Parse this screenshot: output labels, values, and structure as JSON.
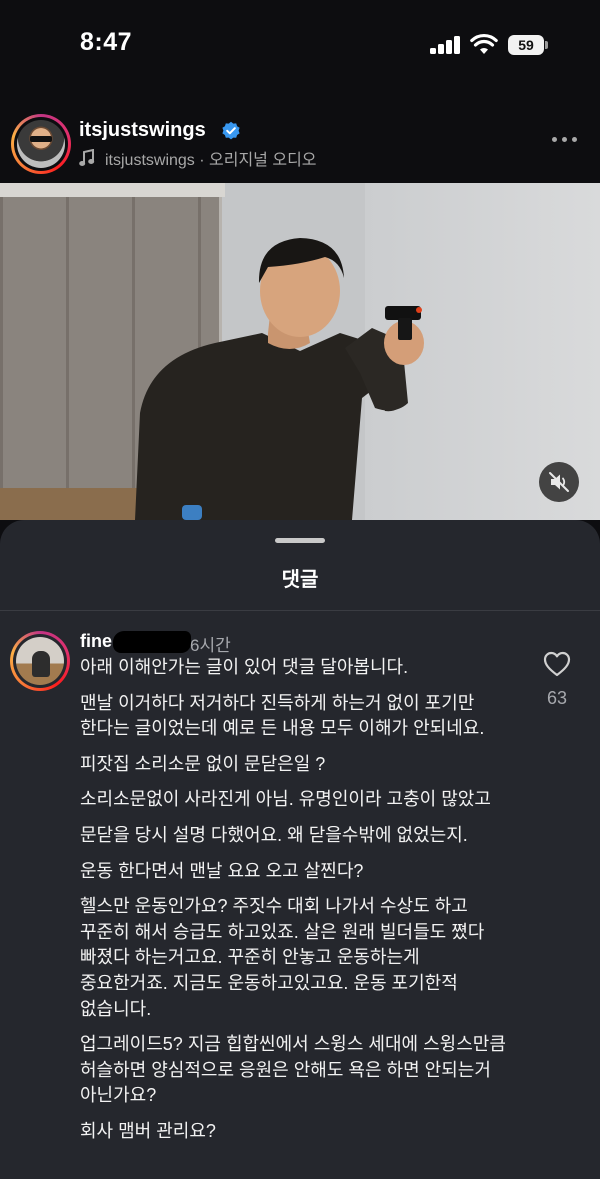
{
  "status_bar": {
    "time": "8:47",
    "battery": "59"
  },
  "post": {
    "username": "itsjustswings",
    "audio_label": "itsjustswings · 오리지널 오디오",
    "verified_color": "#3897f0"
  },
  "comments_sheet": {
    "title": "댓글",
    "comment": {
      "username": "fine",
      "time": "6시간",
      "like_count": "63",
      "paragraphs": [
        "아래 이해안가는 글이 있어 댓글 달아봅니다.",
        "맨날 이거하다 저거하다 진득하게 하는거 없이 포기만 한다는 글이었는데 예로 든 내용 모두 이해가 안되네요.",
        "피잣집 소리소문 없이 문닫은일 ?",
        "소리소문없이 사라진게 아님. 유명인이라 고충이 많았고",
        "문닫을 당시 설명 다했어요. 왜 닫을수밖에 없었는지.",
        "운동 한다면서 맨날 요요 오고 살찐다?",
        "헬스만 운동인가요? 주짓수 대회 나가서 수상도 하고 꾸준히 해서 승급도 하고있죠. 살은 원래 빌더들도 쪘다 빠졌다 하는거고요. 꾸준히 안놓고 운동하는게 중요한거죠. 지금도 운동하고있고요.  운동 포기한적 없습니다.",
        "업그레이드5? 지금 힙합씬에서 스윙스 세대에 스윙스만큼 허슬하면 양심적으로 응원은 안해도 욕은 하면 안되는거 아닌가요?",
        "회사 맴버 관리요?"
      ]
    }
  },
  "icons": {
    "signal": "cellular-signal-icon",
    "wifi": "wifi-icon",
    "battery": "battery-icon",
    "verified": "verified-badge-icon",
    "music": "music-note-icon",
    "more": "more-options-icon",
    "mute": "muted-speaker-icon",
    "heart": "heart-outline-icon"
  }
}
